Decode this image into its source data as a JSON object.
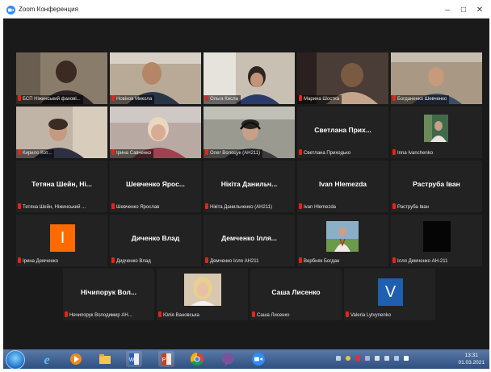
{
  "window": {
    "title": "Zoom Конференция"
  },
  "tiles": [
    {
      "label": "БСП  Ніжинський фахові..."
    },
    {
      "label": "Новіков Микола"
    },
    {
      "label": "Ольга Кисла"
    },
    {
      "label": "Марина Шостка"
    },
    {
      "label": "Богданенко Шевченко"
    },
    {
      "label": "Кирило Кот..."
    },
    {
      "label": "Ірина Савченко"
    },
    {
      "label": "Олег Волоцук (АН211)"
    },
    {
      "label": "Светлана Приходько",
      "center": "Светлана Прих..."
    },
    {
      "label": "Inna Ivanchenko"
    },
    {
      "label": "Тетяна Шейн, Ніжинський ...",
      "center": "Тетяна Шейн, Ні..."
    },
    {
      "label": "Шевченко Ярослав",
      "center": "Шевченко Ярос..."
    },
    {
      "label": "Нікіта Данильченко (АН211)",
      "center": "Нікіта Данильч..."
    },
    {
      "label": "Ivan Hlemezda",
      "center": "Ivan Hlemezda"
    },
    {
      "label": "Раструба Іван",
      "center": "Раструба Іван"
    },
    {
      "label": "Ірина Демченко",
      "avatar": "I"
    },
    {
      "label": "Дидченко Влад",
      "center": "Диченко Влад"
    },
    {
      "label": "Демченко Ілля АН211",
      "center": "Демченко Ілля..."
    },
    {
      "label": "Вербняк Богдан"
    },
    {
      "label": "Ілля Демченко АН-211"
    },
    {
      "label": "Нечипорук Володимир АН...",
      "center": "Нічипорук Вол..."
    },
    {
      "label": "Юлія Вановська"
    },
    {
      "label": "Саша Лисенко",
      "center": "Саша Лисенко"
    },
    {
      "label": "Valeria Lytvynenko",
      "avatar": "V"
    }
  ],
  "colors": {
    "active_speaker": "#d7e24b",
    "zoom_blue": "#2d8cff",
    "avatar_orange": "#ff6a00",
    "avatar_blue": "#1f5fb0"
  },
  "taskbar": {
    "apps": [
      "internet-explorer-icon",
      "media-player-icon",
      "file-explorer-icon",
      "word-icon",
      "powerpoint-icon",
      "chrome-icon",
      "viber-icon",
      "zoom-icon"
    ],
    "time": "13:31",
    "date": "01.03.2021"
  }
}
